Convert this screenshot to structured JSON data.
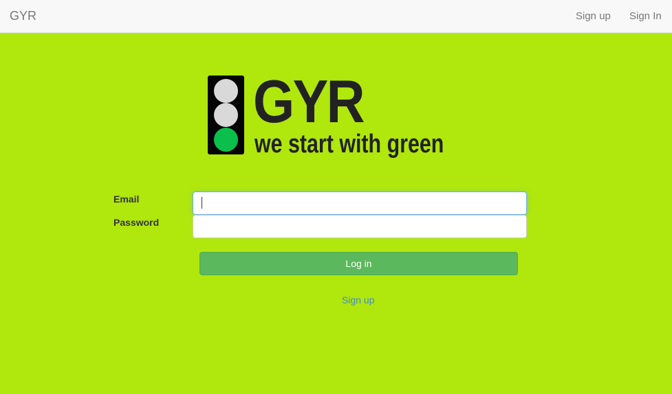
{
  "navbar": {
    "brand": "GYR",
    "links": [
      "Sign up",
      "Sign In"
    ]
  },
  "logo": {
    "word": "GYR",
    "tagline": "we start with green",
    "lamp_colors": [
      "#d9d9d9",
      "#d9d9d9",
      "#0bbf4c"
    ]
  },
  "form": {
    "email_label": "Email",
    "email_value": "",
    "password_label": "Password",
    "password_value": "",
    "submit_label": "Log in"
  },
  "footer_link": "Sign up",
  "colors": {
    "background": "#b0e70d",
    "navbar": "#f8f8f8",
    "button": "#5cb85c",
    "link": "#428bca"
  }
}
